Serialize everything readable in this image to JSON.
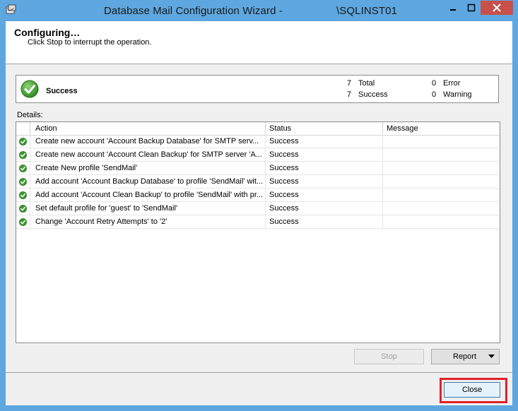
{
  "window": {
    "title_left": "Database Mail Configuration Wizard - ",
    "title_right": "\\SQLINST01"
  },
  "header": {
    "title": "Configuring…",
    "subtitle": "Click Stop to interrupt the operation."
  },
  "summary": {
    "status": "Success",
    "total_count": "7",
    "total_label": "Total",
    "success_count": "7",
    "success_label": "Success",
    "error_count": "0",
    "error_label": "Error",
    "warning_count": "0",
    "warning_label": "Warning"
  },
  "details": {
    "label": "Details:",
    "columns": [
      "Action",
      "Status",
      "Message"
    ],
    "rows": [
      {
        "action": "Create new account 'Account Backup Database' for SMTP serv...",
        "status": "Success",
        "message": ""
      },
      {
        "action": "Create new account 'Account Clean Backup' for SMTP server 'A...",
        "status": "Success",
        "message": ""
      },
      {
        "action": "Create New profile 'SendMail'",
        "status": "Success",
        "message": ""
      },
      {
        "action": "Add account 'Account Backup Database' to profile 'SendMail' wit...",
        "status": "Success",
        "message": ""
      },
      {
        "action": "Add account 'Account Clean Backup' to profile 'SendMail' with pr...",
        "status": "Success",
        "message": ""
      },
      {
        "action": "Set default profile for 'guest' to 'SendMail'",
        "status": "Success",
        "message": ""
      },
      {
        "action": "Change 'Account Retry Attempts' to '2'",
        "status": "Success",
        "message": ""
      }
    ]
  },
  "buttons": {
    "stop": "Stop",
    "report": "Report",
    "close": "Close"
  },
  "colors": {
    "titlebar": "#5ea7e0",
    "success_green": "#3a9a2e",
    "highlight_red": "#e0202a"
  }
}
